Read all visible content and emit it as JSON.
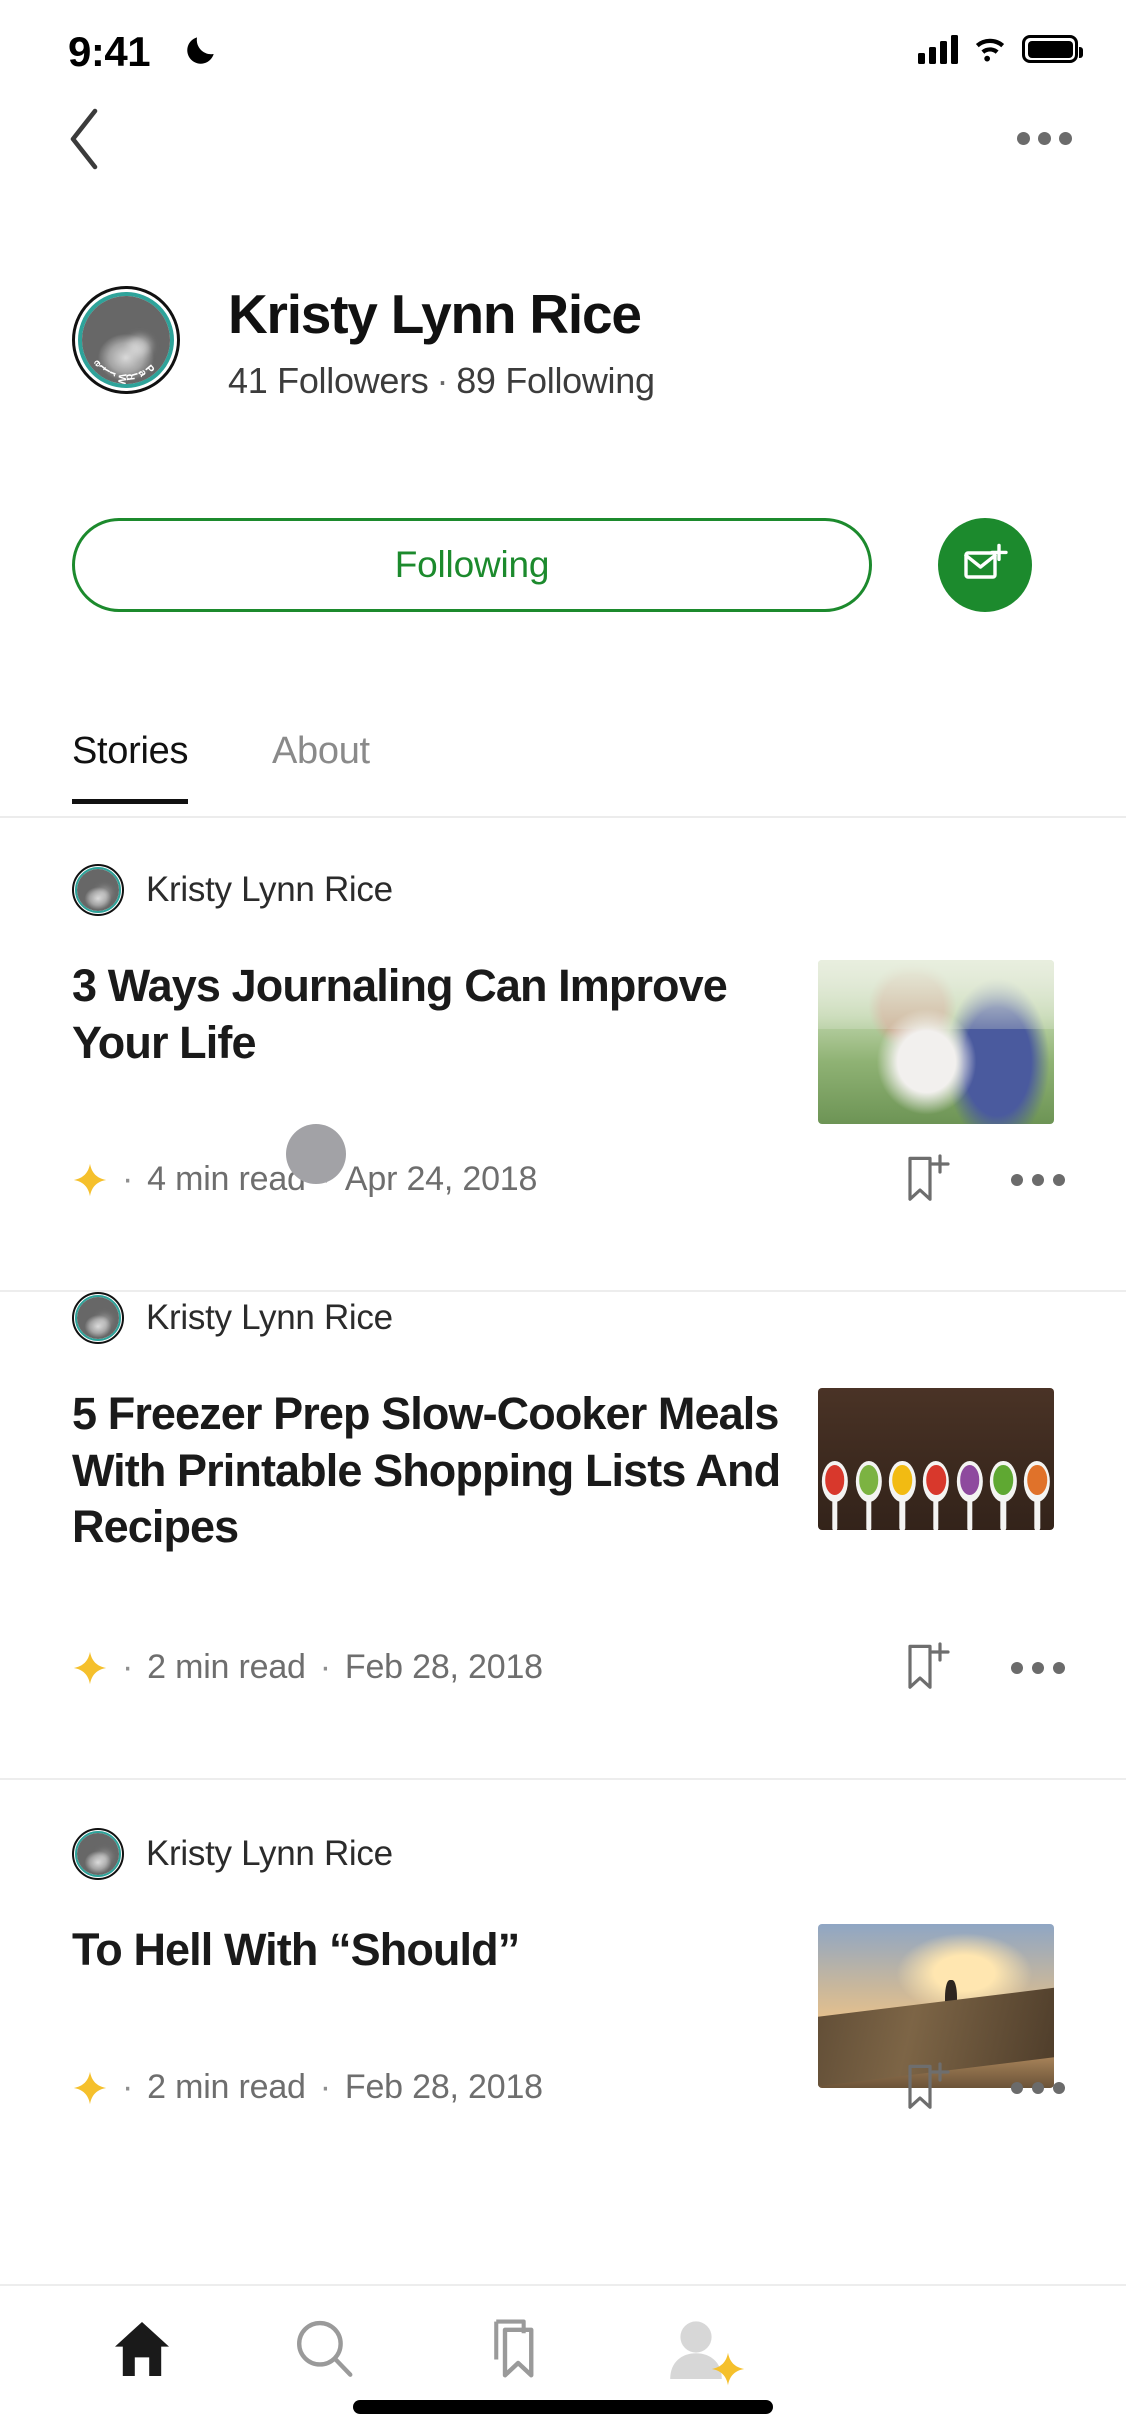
{
  "status_bar": {
    "time": "9:41",
    "dnd_icon": "moon-icon",
    "signal_icon": "cellular-signal-icon",
    "wifi_icon": "wifi-icon",
    "battery_icon": "battery-full-icon"
  },
  "nav": {
    "back_icon": "chevron-left-icon",
    "more_icon": "more-horizontal-icon"
  },
  "profile": {
    "name": "Kristy Lynn Rice",
    "followers": "41 Followers",
    "separator": "·",
    "following": "89 Following",
    "avatar_ring_text": "PaidWrite",
    "avatar_name": "profile-avatar"
  },
  "actions": {
    "follow_label": "Following",
    "follow_color": "#1c8a2d",
    "message_icon": "envelope-plus-icon",
    "message_bg": "#1c8a2d"
  },
  "tabs": {
    "items": [
      {
        "label": "Stories",
        "active": true
      },
      {
        "label": "About",
        "active": false
      }
    ]
  },
  "stories": [
    {
      "author": "Kristy Lynn Rice",
      "title": "3 Ways Journaling Can Improve Your Life",
      "member_star": "star-icon",
      "read_time": "4  min read",
      "date": "Apr 24, 2018",
      "sep": "·",
      "bookmark_icon": "bookmark-plus-icon",
      "more_icon": "more-horizontal-icon",
      "thumbnail": "woman-journaling-outdoors"
    },
    {
      "author": "Kristy Lynn Rice",
      "title": "5 Freezer Prep Slow-Cooker Meals With Printable Shopping Lists And Recipes",
      "member_star": "star-icon",
      "read_time": "2  min read",
      "date": "Feb 28, 2018",
      "sep": "·",
      "bookmark_icon": "bookmark-plus-icon",
      "more_icon": "more-horizontal-icon",
      "thumbnail": "chopped-vegetables-in-spoons"
    },
    {
      "author": "Kristy Lynn Rice",
      "title": "To Hell With “Should”",
      "member_star": "star-icon",
      "read_time": "2  min read",
      "date": "Feb 28, 2018",
      "sep": "·",
      "bookmark_icon": "bookmark-plus-icon",
      "more_icon": "more-horizontal-icon",
      "thumbnail": "person-on-cliff-at-sunset"
    }
  ],
  "bottom_bar": {
    "items": [
      {
        "name": "home-tab",
        "icon": "home-icon",
        "active": true
      },
      {
        "name": "search-tab",
        "icon": "search-icon",
        "active": false
      },
      {
        "name": "bookmarks-tab",
        "icon": "bookmark-icon",
        "active": false
      },
      {
        "name": "profile-tab",
        "icon": "person-icon",
        "active": false,
        "badge": "star-icon"
      }
    ]
  },
  "colors": {
    "accent_green": "#1c8a2d",
    "star_yellow": "#f5c02c",
    "avatar_ring_teal": "#2ea39a",
    "text_primary": "#111111",
    "text_secondary": "#6e6e6e",
    "divider": "#ededed"
  }
}
